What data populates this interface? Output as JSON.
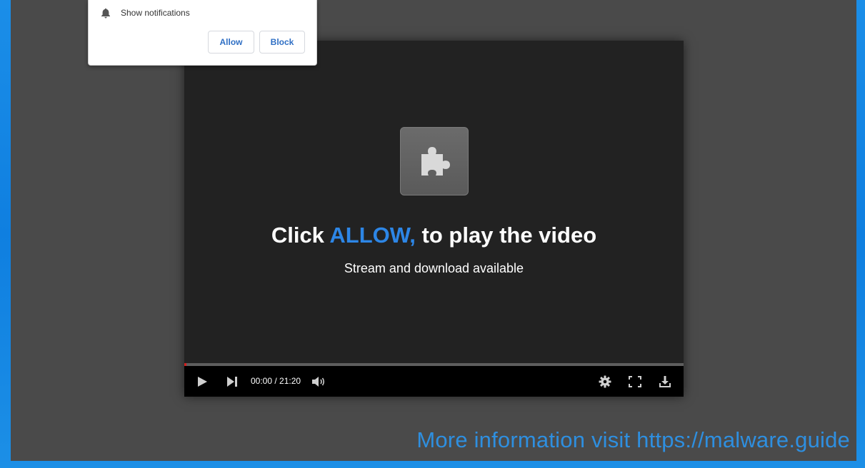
{
  "notification": {
    "message": "Show notifications",
    "allow_label": "Allow",
    "block_label": "Block"
  },
  "player": {
    "headline_prefix": "Click ",
    "headline_highlight": "ALLOW,",
    "headline_suffix": " to play the video",
    "subtitle": "Stream and download available",
    "time": "00:00 / 21:20",
    "progress_fraction": 0.005,
    "icons": {
      "plugin": "puzzle-piece-icon",
      "play": "play-icon",
      "next": "skip-next-icon",
      "volume": "volume-icon",
      "settings": "gear-icon",
      "fullscreen": "fullscreen-icon",
      "download": "download-icon"
    }
  },
  "watermark": "More information visit https://malware.guide",
  "colors": {
    "highlight": "#2d86e6",
    "progress": "#d21f1f",
    "watermark": "#2e8fe0",
    "button_text": "#2f6fc4"
  }
}
